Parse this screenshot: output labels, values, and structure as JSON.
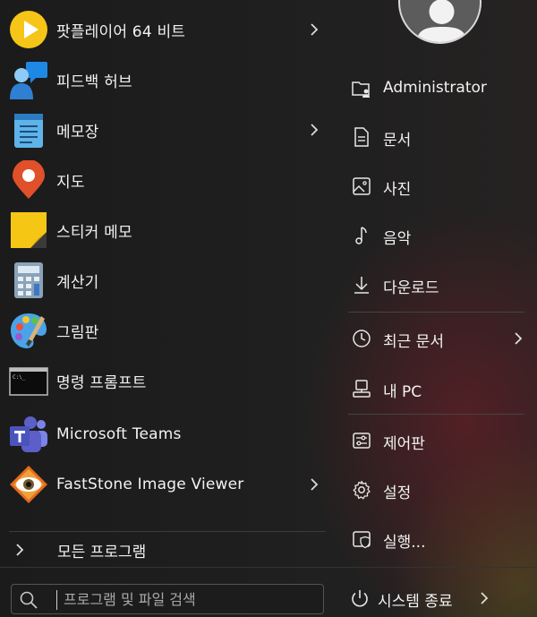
{
  "apps": [
    {
      "label": "팟플레이어 64 비트",
      "icon": "potplayer-icon",
      "has_submenu": true
    },
    {
      "label": "피드백 허브",
      "icon": "feedback-hub-icon",
      "has_submenu": false
    },
    {
      "label": "메모장",
      "icon": "notepad-icon",
      "has_submenu": true
    },
    {
      "label": "지도",
      "icon": "maps-icon",
      "has_submenu": false
    },
    {
      "label": "스티커 메모",
      "icon": "sticky-notes-icon",
      "has_submenu": false
    },
    {
      "label": "계산기",
      "icon": "calculator-icon",
      "has_submenu": false
    },
    {
      "label": "그림판",
      "icon": "paint-icon",
      "has_submenu": false
    },
    {
      "label": "명령 프롬프트",
      "icon": "command-prompt-icon",
      "has_submenu": false
    },
    {
      "label": "Microsoft Teams",
      "icon": "teams-icon",
      "has_submenu": false
    },
    {
      "label": "FastStone Image Viewer",
      "icon": "faststone-icon",
      "has_submenu": true
    }
  ],
  "all_programs": {
    "label": "모든 프로그램"
  },
  "search": {
    "placeholder": "프로그램 및 파일 검색",
    "value": ""
  },
  "right_menu": [
    {
      "label": "Administrator",
      "icon": "user-folder-icon"
    },
    {
      "label": "문서",
      "icon": "document-icon"
    },
    {
      "label": "사진",
      "icon": "picture-icon"
    },
    {
      "label": "음악",
      "icon": "music-note-icon"
    },
    {
      "label": "다운로드",
      "icon": "download-icon"
    },
    {
      "label": "최근 문서",
      "icon": "clock-icon",
      "has_submenu": true
    },
    {
      "label": "내 PC",
      "icon": "computer-icon"
    },
    {
      "label": "제어판",
      "icon": "control-panel-icon"
    },
    {
      "label": "설정",
      "icon": "gear-icon"
    },
    {
      "label": "실행...",
      "icon": "run-shield-icon"
    }
  ],
  "shutdown": {
    "label": "시스템 종료",
    "icon": "power-icon"
  },
  "colors": {
    "background": "#202020",
    "text": "#f2f2f2",
    "divider": "#444444"
  }
}
